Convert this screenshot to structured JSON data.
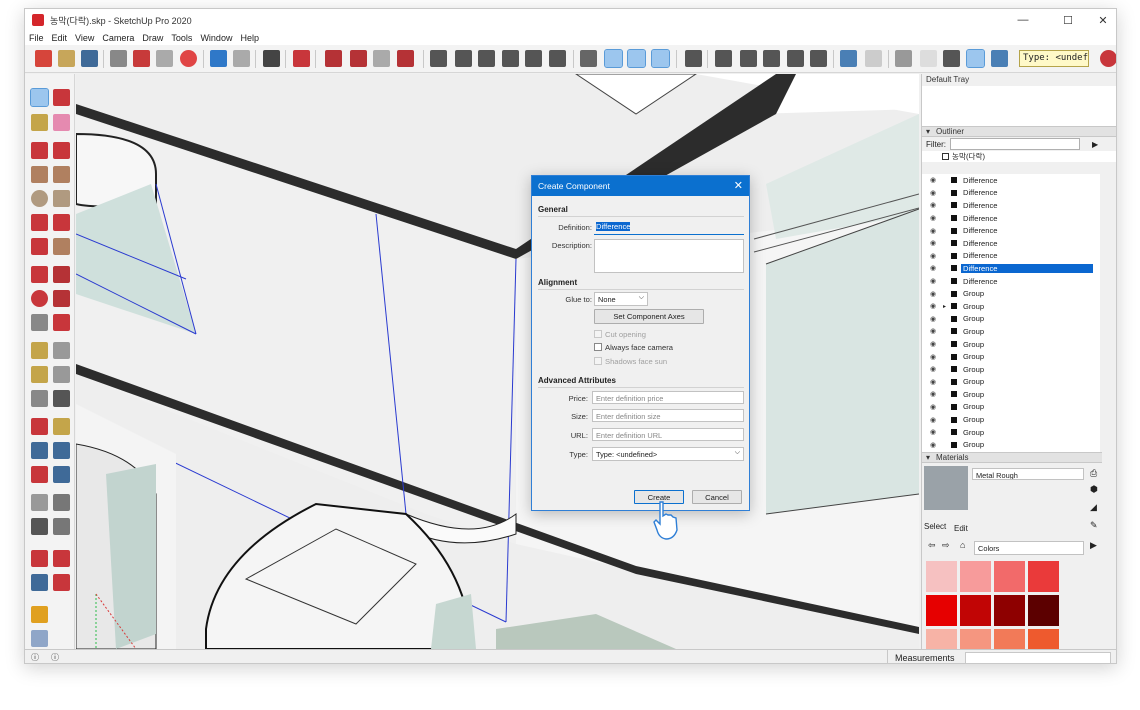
{
  "window": {
    "title": "농막(다락).skp - SketchUp Pro 2020",
    "min": "—",
    "max": "☐",
    "close": "✕"
  },
  "menu": [
    "File",
    "Edit",
    "View",
    "Camera",
    "Draw",
    "Tools",
    "Window",
    "Help"
  ],
  "toolbar": {
    "type_field": "Type: <undefined>"
  },
  "tray": {
    "title": "Default Tray",
    "outliner": {
      "title": "Outliner",
      "filter_label": "Filter:",
      "root": "농막(다락)",
      "items": [
        {
          "label": "Difference",
          "selected": false,
          "expand": false
        },
        {
          "label": "Difference",
          "selected": false,
          "expand": false
        },
        {
          "label": "Difference",
          "selected": false,
          "expand": false
        },
        {
          "label": "Difference",
          "selected": false,
          "expand": false
        },
        {
          "label": "Difference",
          "selected": false,
          "expand": false
        },
        {
          "label": "Difference",
          "selected": false,
          "expand": false
        },
        {
          "label": "Difference",
          "selected": false,
          "expand": false
        },
        {
          "label": "Difference",
          "selected": true,
          "expand": false
        },
        {
          "label": "Difference",
          "selected": false,
          "expand": false
        },
        {
          "label": "Group",
          "selected": false,
          "expand": false
        },
        {
          "label": "Group",
          "selected": false,
          "expand": true
        },
        {
          "label": "Group",
          "selected": false,
          "expand": false
        },
        {
          "label": "Group",
          "selected": false,
          "expand": false
        },
        {
          "label": "Group",
          "selected": false,
          "expand": false
        },
        {
          "label": "Group",
          "selected": false,
          "expand": false
        },
        {
          "label": "Group",
          "selected": false,
          "expand": false
        },
        {
          "label": "Group",
          "selected": false,
          "expand": false
        },
        {
          "label": "Group",
          "selected": false,
          "expand": false
        },
        {
          "label": "Group",
          "selected": false,
          "expand": false
        },
        {
          "label": "Group",
          "selected": false,
          "expand": false
        },
        {
          "label": "Group",
          "selected": false,
          "expand": false
        },
        {
          "label": "Group",
          "selected": false,
          "expand": false
        }
      ]
    },
    "materials": {
      "title": "Materials",
      "name": "Metal Rough",
      "tab_select": "Select",
      "tab_edit": "Edit",
      "library": "Colors",
      "swatches": [
        "#f6c1c1",
        "#f79b9b",
        "#f26a6a",
        "#ea3a3a",
        "#e60000",
        "#c10505",
        "#8e0000",
        "#5c0000",
        "#f7b3a6",
        "#f59680",
        "#f27a58",
        "#ee5a2e"
      ]
    }
  },
  "dialog": {
    "title": "Create Component",
    "close": "✕",
    "general": "General",
    "definition_label": "Definition:",
    "definition_value": "Difference",
    "description_label": "Description:",
    "alignment": "Alignment",
    "glue_label": "Glue to:",
    "glue_value": "None",
    "set_axes": "Set Component Axes",
    "cut_opening": "Cut opening",
    "always_face_camera": "Always face camera",
    "shadows_face_sun": "Shadows face sun",
    "advanced": "Advanced Attributes",
    "price_label": "Price:",
    "price_placeholder": "Enter definition price",
    "size_label": "Size:",
    "size_placeholder": "Enter definition size",
    "url_label": "URL:",
    "url_placeholder": "Enter definition URL",
    "type_label": "Type:",
    "type_value": "Type: <undefined>",
    "create": "Create",
    "cancel": "Cancel"
  },
  "status": {
    "measurements": "Measurements"
  }
}
